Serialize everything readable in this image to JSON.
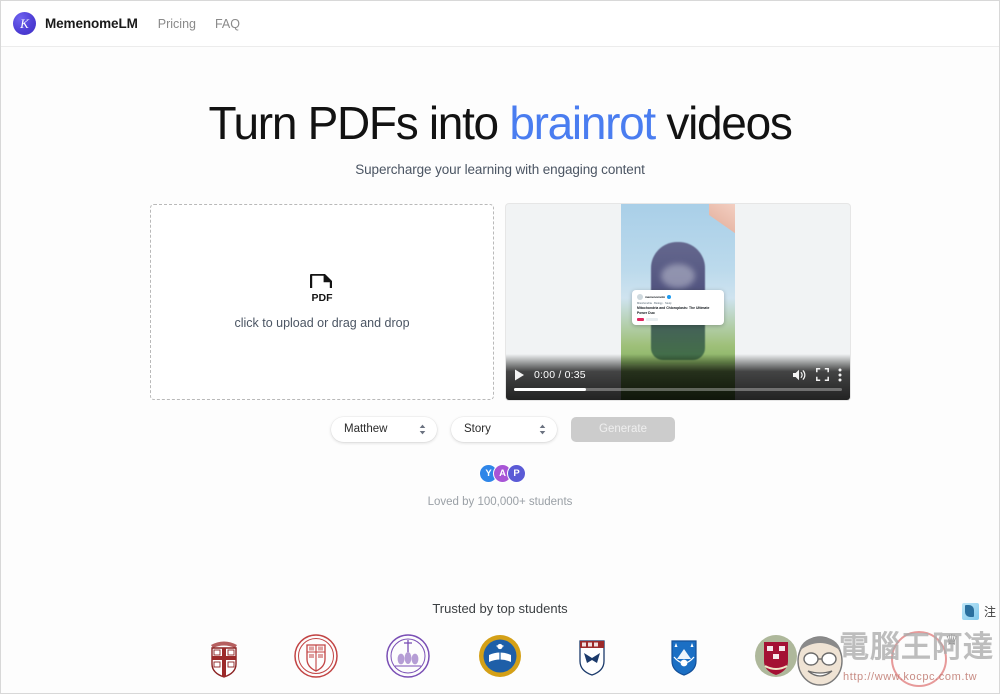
{
  "nav": {
    "brand_glyph": "K",
    "brand_name": "MemenomeLM",
    "links": [
      {
        "label": "Pricing",
        "name": "nav-link-pricing"
      },
      {
        "label": "FAQ",
        "name": "nav-link-faq"
      }
    ]
  },
  "hero": {
    "headline_part1": "Turn PDFs into ",
    "headline_accent": "brainrot",
    "headline_part2": " videos",
    "accent_color": "#4a7df0",
    "subhead": "Supercharge your learning with engaging content"
  },
  "upload": {
    "icon": "pdf-file-icon",
    "icon_label": "PDF",
    "label": "click to upload or drag and drop"
  },
  "video": {
    "current_time": "0:00",
    "duration": "0:35",
    "time_display": "0:00 / 0:35",
    "progress_percent": 22,
    "play_icon": "play-icon",
    "volume_icon": "volume-icon",
    "fullscreen_icon": "fullscreen-icon",
    "more_icon": "kebab-menu-icon",
    "overlay_card": {
      "handle": "memenomelm",
      "subtext": "Mitochondria · Biology · Study",
      "title": "Mitochondria and Chloroplasts: The Ultimate Power Duo"
    }
  },
  "controls": {
    "voice_select": {
      "value": "Matthew",
      "stepper_icon": "stepper-chevrons-icon"
    },
    "style_select": {
      "value": "Story",
      "stepper_icon": "stepper-chevrons-icon"
    },
    "generate_button": {
      "label": "Generate",
      "disabled": true,
      "bg_color": "#cccccc"
    }
  },
  "social_proof": {
    "avatars": [
      {
        "initial": "Y",
        "color": "#2f86e8"
      },
      {
        "initial": "A",
        "color": "#a855d6"
      },
      {
        "initial": "P",
        "color": "#5b5bd6"
      }
    ],
    "loved_text": "Loved by 100,000+ students"
  },
  "trusted": {
    "title": "Trusted by top students",
    "logos": [
      {
        "name": "brown-university-seal",
        "color": "#9c2a2a"
      },
      {
        "name": "cornell-university-seal",
        "color": "#c24444"
      },
      {
        "name": "northwestern-university-seal",
        "color": "#7a4fb5"
      },
      {
        "name": "uc-irvine-seal",
        "color": "#d4a017"
      },
      {
        "name": "university-of-pennsylvania-shield",
        "color": "#1b3a6b"
      },
      {
        "name": "columbia-university-shield",
        "color": "#1b6fc4"
      },
      {
        "name": "harvard-university-seal",
        "color": "#a41034"
      }
    ]
  },
  "watermark": {
    "text": "電腦王阿達",
    "url": "http://www.kocpc.com.tw",
    "crown": "♛",
    "badge_char": "注"
  }
}
